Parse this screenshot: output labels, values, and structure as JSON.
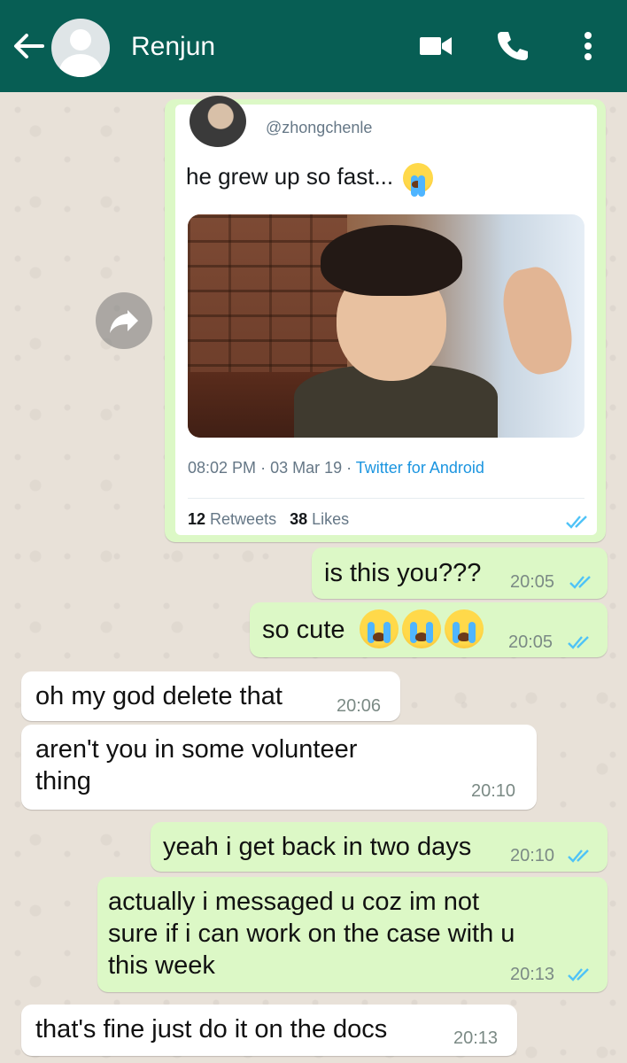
{
  "header": {
    "contact_name": "Renjun",
    "icons": [
      "back-arrow-icon",
      "avatar-placeholder",
      "video-call-icon",
      "phone-call-icon",
      "more-vert-icon"
    ],
    "bar_color": "#075e54"
  },
  "tweet": {
    "handle": "@zhongchenle",
    "text": "he grew up so fast...",
    "time": "08:02 PM",
    "date": "03 Mar 19",
    "source": "Twitter for Android",
    "retweets": "12",
    "retweets_label": "Retweets",
    "likes": "38",
    "likes_label": "Likes"
  },
  "messages": [
    {
      "dir": "out",
      "text": "is this you???",
      "time": "20:05"
    },
    {
      "dir": "out",
      "text": "so cute",
      "time": "20:05",
      "emoji": "loudly-crying-face x3"
    },
    {
      "dir": "in",
      "text": "oh my god delete that",
      "time": "20:06"
    },
    {
      "dir": "in",
      "text": "aren't you in some volunteer\nthing",
      "time": "20:10"
    },
    {
      "dir": "out",
      "text": "yeah i get back in two days",
      "time": "20:10"
    },
    {
      "dir": "out",
      "text": "actually i messaged u coz im not\nsure if i can work on the case with u\nthis week",
      "time": "20:13"
    },
    {
      "dir": "in",
      "text": "that's fine just do it on the docs",
      "time": "20:13"
    }
  ],
  "colors": {
    "outgoing_bubble": "#dcf8c6",
    "incoming_bubble": "#ffffff",
    "read_ticks": "#4fc3f7",
    "twitter_link": "#1b95e0"
  }
}
